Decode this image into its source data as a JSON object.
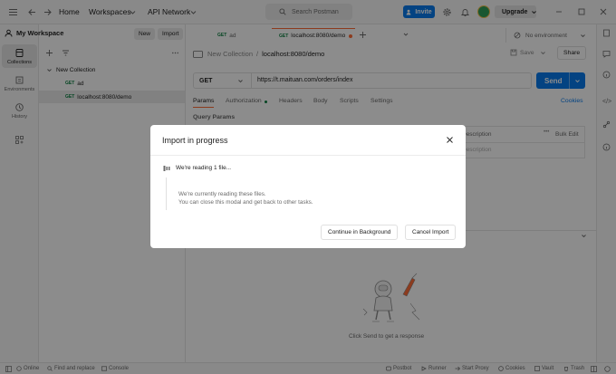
{
  "topbar": {
    "home": "Home",
    "workspaces": "Workspaces",
    "api_network": "API Network",
    "search_placeholder": "Search Postman",
    "invite": "Invite",
    "upgrade": "Upgrade"
  },
  "rail": {
    "collections": "Collections",
    "environments": "Environments",
    "history": "History"
  },
  "sidebar": {
    "workspace_title": "My Workspace",
    "new_button": "New",
    "import_button": "Import",
    "tree": {
      "collection": "New Collection",
      "items": [
        {
          "method": "GET",
          "name": "ad"
        },
        {
          "method": "GET",
          "name": "localhost:8080/demo"
        }
      ]
    }
  },
  "tabs": [
    {
      "method": "GET",
      "name": "ad"
    },
    {
      "method": "GET",
      "name": "localhost:8080/demo"
    }
  ],
  "environment": "No environment",
  "breadcrumb": {
    "parent": "New Collection",
    "separator": "/",
    "current": "localhost:8080/demo"
  },
  "actions": {
    "save": "Save",
    "share": "Share"
  },
  "request": {
    "method": "GET",
    "url": "https://t.maituan.com/orders/index",
    "send": "Send"
  },
  "request_tabs": [
    "Params",
    "Authorization",
    "Headers",
    "Body",
    "Scripts",
    "Settings"
  ],
  "cookies": "Cookies",
  "query_params": "Query Params",
  "params_table": {
    "description_header": "Description",
    "bulk_edit": "Bulk Edit",
    "description_placeholder": "Description"
  },
  "response": {
    "hint": "Click Send to get a response"
  },
  "statusbar": {
    "online": "Online",
    "find_replace": "Find and replace",
    "console": "Console",
    "postbot": "Postbot",
    "runner": "Runner",
    "start_proxy": "Start Proxy",
    "cookies": "Cookies",
    "vault": "Vault",
    "trash": "Trash"
  },
  "modal": {
    "title": "Import in progress",
    "reading": "We're reading 1 file...",
    "desc_line1": "We're currently reading these files.",
    "desc_line2": "You can close this modal and get back to other tasks.",
    "continue_button": "Continue in Background",
    "cancel_button": "Cancel Import"
  },
  "colors": {
    "accent": "#097bed",
    "brand": "#ff6c37",
    "get": "#0a7f3f"
  }
}
